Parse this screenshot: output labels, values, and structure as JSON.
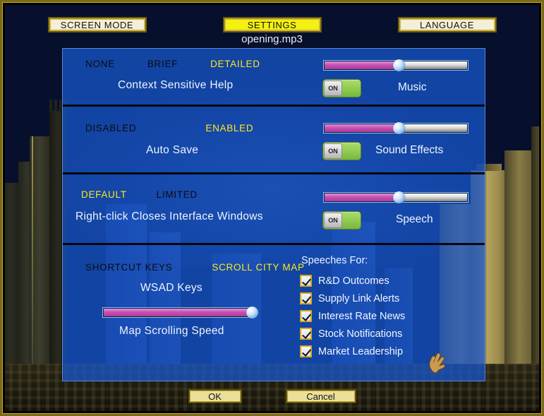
{
  "window": {
    "now_playing": "opening.mp3"
  },
  "tabs": [
    {
      "label": "SCREEN MODE",
      "active": false
    },
    {
      "label": "SETTINGS",
      "active": true
    },
    {
      "label": "LANGUAGE",
      "active": false
    }
  ],
  "rows": [
    {
      "id": "context-help",
      "options": [
        "NONE",
        "BRIEF",
        "DETAILED"
      ],
      "selected": "DETAILED",
      "label": "Context  Sensitive  Help",
      "audio": {
        "name": "Music",
        "toggle_state": "ON",
        "toggle_on": true,
        "volume_percent": 52
      }
    },
    {
      "id": "auto-save",
      "options": [
        "DISABLED",
        "ENABLED"
      ],
      "selected": "ENABLED",
      "label": "Auto  Save",
      "audio": {
        "name": "Sound  Effects",
        "toggle_state": "ON",
        "toggle_on": true,
        "volume_percent": 52
      }
    },
    {
      "id": "right-click",
      "options": [
        "DEFAULT",
        "LIMITED"
      ],
      "selected": "DEFAULT",
      "label": "Right-click  Closes  Interface  Windows",
      "audio": {
        "name": "Speech",
        "toggle_state": "ON",
        "toggle_on": true,
        "volume_percent": 52
      }
    },
    {
      "id": "shortcut-keys",
      "options": [
        "SHORTCUT KEYS",
        "SCROLL CITY MAP"
      ],
      "selected": "SCROLL CITY MAP",
      "label": "WSAD  Keys",
      "speed": {
        "name": "Map  Scrolling  Speed",
        "percent": 100
      }
    }
  ],
  "speeches": {
    "title": "Speeches For:",
    "items": [
      {
        "label": "R&D  Outcomes",
        "checked": true
      },
      {
        "label": "Supply  Link  Alerts",
        "checked": true
      },
      {
        "label": "Interest  Rate  News",
        "checked": true
      },
      {
        "label": "Stock  Notifications",
        "checked": true
      },
      {
        "label": "Market  Leadership",
        "checked": true
      }
    ]
  },
  "buttons": {
    "ok": "OK",
    "cancel": "Cancel"
  },
  "colors": {
    "highlight_yellow": "#ffe81c",
    "tab_active": "#f3f10f",
    "panel_blue": "#1756cd",
    "slider_fill": "#c850b4",
    "toggle_green": "#8ecb4e",
    "checkbox_gold": "#d7a81b",
    "frame_gold": "#c8ab30"
  }
}
